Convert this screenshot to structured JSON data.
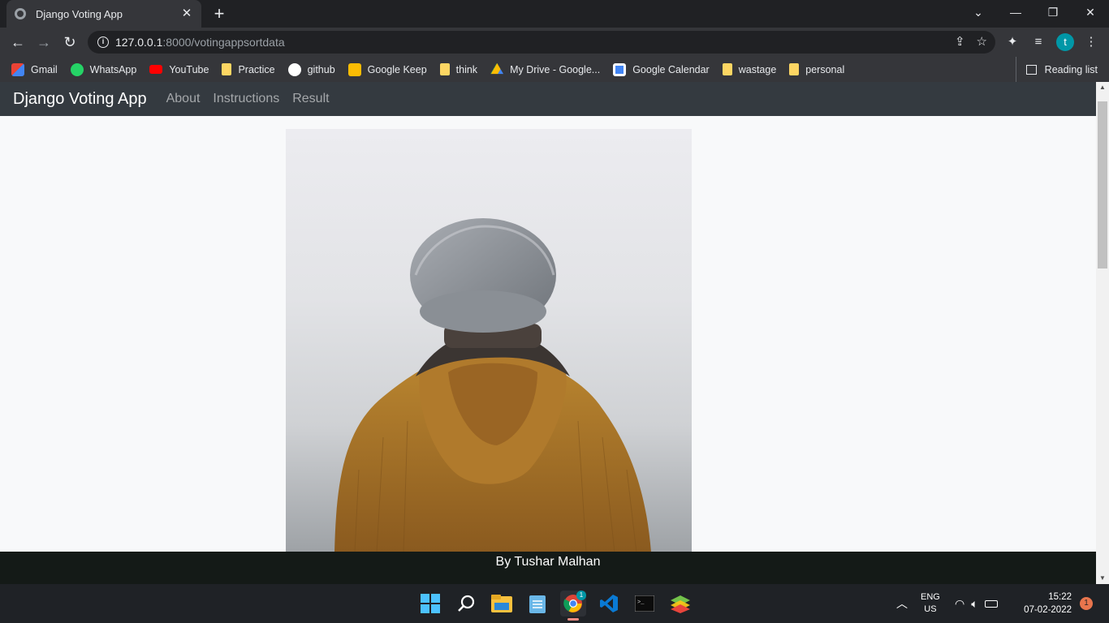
{
  "browser": {
    "tab_title": "Django Voting App",
    "url_host": "127.0.0.1",
    "url_path": ":8000/votingappsortdata",
    "profile_initial": "t",
    "bookmarks": [
      {
        "label": "Gmail",
        "icon": "gmail-icon",
        "color": "#ea4335"
      },
      {
        "label": "WhatsApp",
        "icon": "whatsapp-icon",
        "color": "#25d366"
      },
      {
        "label": "YouTube",
        "icon": "youtube-icon",
        "color": "#ff0000"
      },
      {
        "label": "Practice",
        "icon": "folder-icon",
        "color": "#fdd663"
      },
      {
        "label": "github",
        "icon": "github-icon",
        "color": "#ffffff"
      },
      {
        "label": "Google Keep",
        "icon": "keep-icon",
        "color": "#fbbc04"
      },
      {
        "label": "think",
        "icon": "folder-icon",
        "color": "#fdd663"
      },
      {
        "label": "My Drive - Google...",
        "icon": "drive-icon",
        "color": "#34a853"
      },
      {
        "label": "Google Calendar",
        "icon": "calendar-icon",
        "color": "#4285f4"
      },
      {
        "label": "wastage",
        "icon": "folder-icon",
        "color": "#fdd663"
      },
      {
        "label": "personal",
        "icon": "folder-icon",
        "color": "#fdd663"
      }
    ],
    "reading_list": "Reading list"
  },
  "app": {
    "brand": "Django Voting App",
    "nav": [
      "About",
      "Instructions",
      "Result"
    ],
    "footer": "By Tushar Malhan"
  },
  "taskbar": {
    "chrome_badge": "1",
    "lang_line1": "ENG",
    "lang_line2": "US",
    "time": "15:22",
    "date": "07-02-2022",
    "notification_count": "1"
  }
}
